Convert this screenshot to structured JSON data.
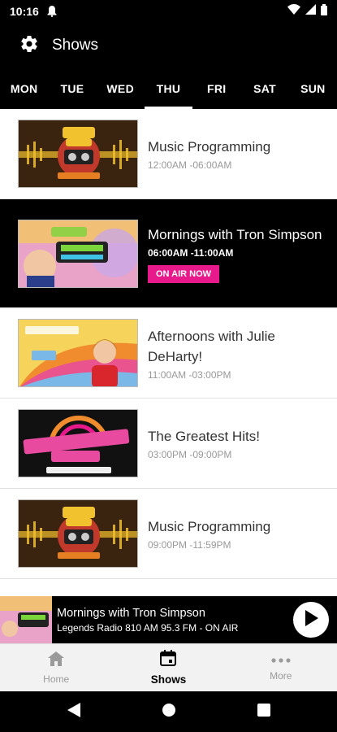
{
  "status_bar": {
    "time": "10:16"
  },
  "app_bar": {
    "title": "Shows"
  },
  "days": [
    "MON",
    "TUE",
    "WED",
    "THU",
    "FRI",
    "SAT",
    "SUN"
  ],
  "active_day": "THU",
  "shows": [
    {
      "title": "Music Programming",
      "time": "12:00AM -06:00AM",
      "live": false,
      "art": "legends-radio-logo"
    },
    {
      "title": "Mornings with Tron Simpson",
      "time": "06:00AM -11:00AM",
      "live": true,
      "badge": "ON AIR NOW",
      "art": "mornings-tron"
    },
    {
      "title": "Afternoons with Julie DeHarty!",
      "time": "11:00AM -03:00PM",
      "live": false,
      "art": "afternoons-julie"
    },
    {
      "title": "The Greatest Hits!",
      "time": "03:00PM -09:00PM",
      "live": false,
      "art": "greatest-hits"
    },
    {
      "title": "Music Programming",
      "time": "09:00PM -11:59PM",
      "live": false,
      "art": "legends-radio-logo"
    }
  ],
  "now_playing": {
    "title": "Mornings with Tron Simpson",
    "subtitle": "Legends Radio 810 AM 95.3 FM - ON AIR"
  },
  "bottom_nav": {
    "home": "Home",
    "shows": "Shows",
    "more": "More"
  },
  "colors": {
    "accent": "#e8198b",
    "background": "#000000"
  }
}
